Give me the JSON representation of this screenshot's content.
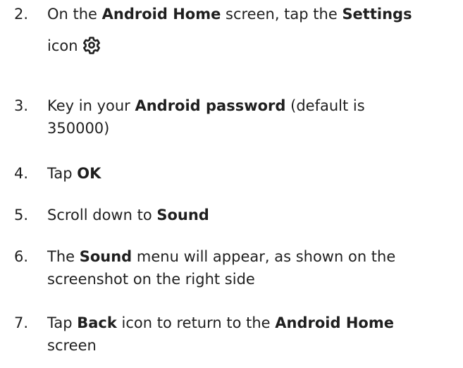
{
  "steps": [
    {
      "number": "2.",
      "parts": {
        "a": "On the ",
        "b": "Android Home",
        "c": " screen, tap the ",
        "d": "Settings",
        "e": "icon"
      },
      "icon": "gear-icon"
    },
    {
      "number": "3.",
      "parts": {
        "a": "Key in your ",
        "b": "Android password",
        "c": " (default is",
        "d": "350000)"
      }
    },
    {
      "number": "4.",
      "parts": {
        "a": "Tap ",
        "b": "OK"
      }
    },
    {
      "number": "5.",
      "parts": {
        "a": "Scroll down to ",
        "b": "Sound"
      }
    },
    {
      "number": "6.",
      "parts": {
        "a": "The ",
        "b": "Sound",
        "c": " menu will appear, as shown on the",
        "d": "screenshot on the right side"
      }
    },
    {
      "number": "7.",
      "parts": {
        "a": "Tap ",
        "b": "Back",
        "c": " icon to return to the ",
        "d": "Android Home",
        "e": "screen"
      }
    }
  ],
  "colors": {
    "text": "#1f1f1f",
    "background": "#ffffff"
  }
}
